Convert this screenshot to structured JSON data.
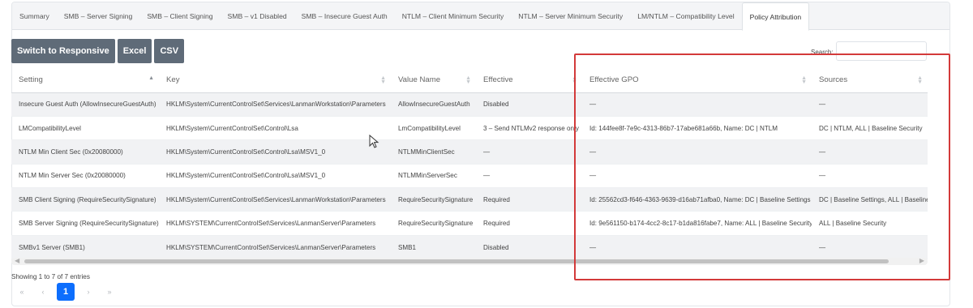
{
  "tabs": [
    {
      "label": "Summary"
    },
    {
      "label": "SMB – Server Signing"
    },
    {
      "label": "SMB – Client Signing"
    },
    {
      "label": "SMB – v1 Disabled"
    },
    {
      "label": "SMB – Insecure Guest Auth"
    },
    {
      "label": "NTLM – Client Minimum Security"
    },
    {
      "label": "NTLM – Server Minimum Security"
    },
    {
      "label": "LM/NTLM – Compatibility Level"
    },
    {
      "label": "Policy Attribution"
    }
  ],
  "active_tab": 8,
  "toolbar": {
    "responsive_label": "Switch to Responsive",
    "excel_label": "Excel",
    "csv_label": "CSV"
  },
  "search": {
    "label": "Search:",
    "value": ""
  },
  "table": {
    "columns": [
      "Setting",
      "Key",
      "Value Name",
      "Effective",
      "Effective GPO",
      "Sources"
    ],
    "rows": [
      [
        "Insecure Guest Auth (AllowInsecureGuestAuth)",
        "HKLM\\System\\CurrentControlSet\\Services\\LanmanWorkstation\\Parameters",
        "AllowInsecureGuestAuth",
        "Disabled",
        "—",
        "—"
      ],
      [
        "LMCompatibilityLevel",
        "HKLM\\System\\CurrentControlSet\\Control\\Lsa",
        "LmCompatibilityLevel",
        "3 – Send NTLMv2 response only",
        "Id: 144fee8f-7e9c-4313-86b7-17abe681a66b, Name: DC | NTLM",
        "DC | NTLM, ALL | Baseline Security"
      ],
      [
        "NTLM Min Client Sec (0x20080000)",
        "HKLM\\System\\CurrentControlSet\\Control\\Lsa\\MSV1_0",
        "NTLMMinClientSec",
        "—",
        "—",
        "—"
      ],
      [
        "NTLM Min Server Sec (0x20080000)",
        "HKLM\\System\\CurrentControlSet\\Control\\Lsa\\MSV1_0",
        "NTLMMinServerSec",
        "—",
        "—",
        "—"
      ],
      [
        "SMB Client Signing (RequireSecuritySignature)",
        "HKLM\\System\\CurrentControlSet\\Services\\LanmanWorkstation\\Parameters",
        "RequireSecuritySignature",
        "Required",
        "Id: 25562cd3-f646-4363-9639-d16ab71afba0, Name: DC | Baseline Settings",
        "DC | Baseline Settings, ALL | Baseline S"
      ],
      [
        "SMB Server Signing (RequireSecuritySignature)",
        "HKLM\\SYSTEM\\CurrentControlSet\\Services\\LanmanServer\\Parameters",
        "RequireSecuritySignature",
        "Required",
        "Id: 9e561150-b174-4cc2-8c17-b1da816fabe7, Name: ALL | Baseline Security",
        "ALL | Baseline Security"
      ],
      [
        "SMBv1 Server (SMB1)",
        "HKLM\\SYSTEM\\CurrentControlSet\\Services\\LanmanServer\\Parameters",
        "SMB1",
        "Disabled",
        "—",
        "—"
      ]
    ]
  },
  "info_text": "Showing 1 to 7 of 7 entries",
  "pagination": {
    "first": "«",
    "prev": "‹",
    "current": "1",
    "next": "›",
    "last": "»"
  },
  "colors": {
    "accent": "#0d6efd",
    "button": "#5f6b78",
    "highlight": "#d33a3a"
  }
}
